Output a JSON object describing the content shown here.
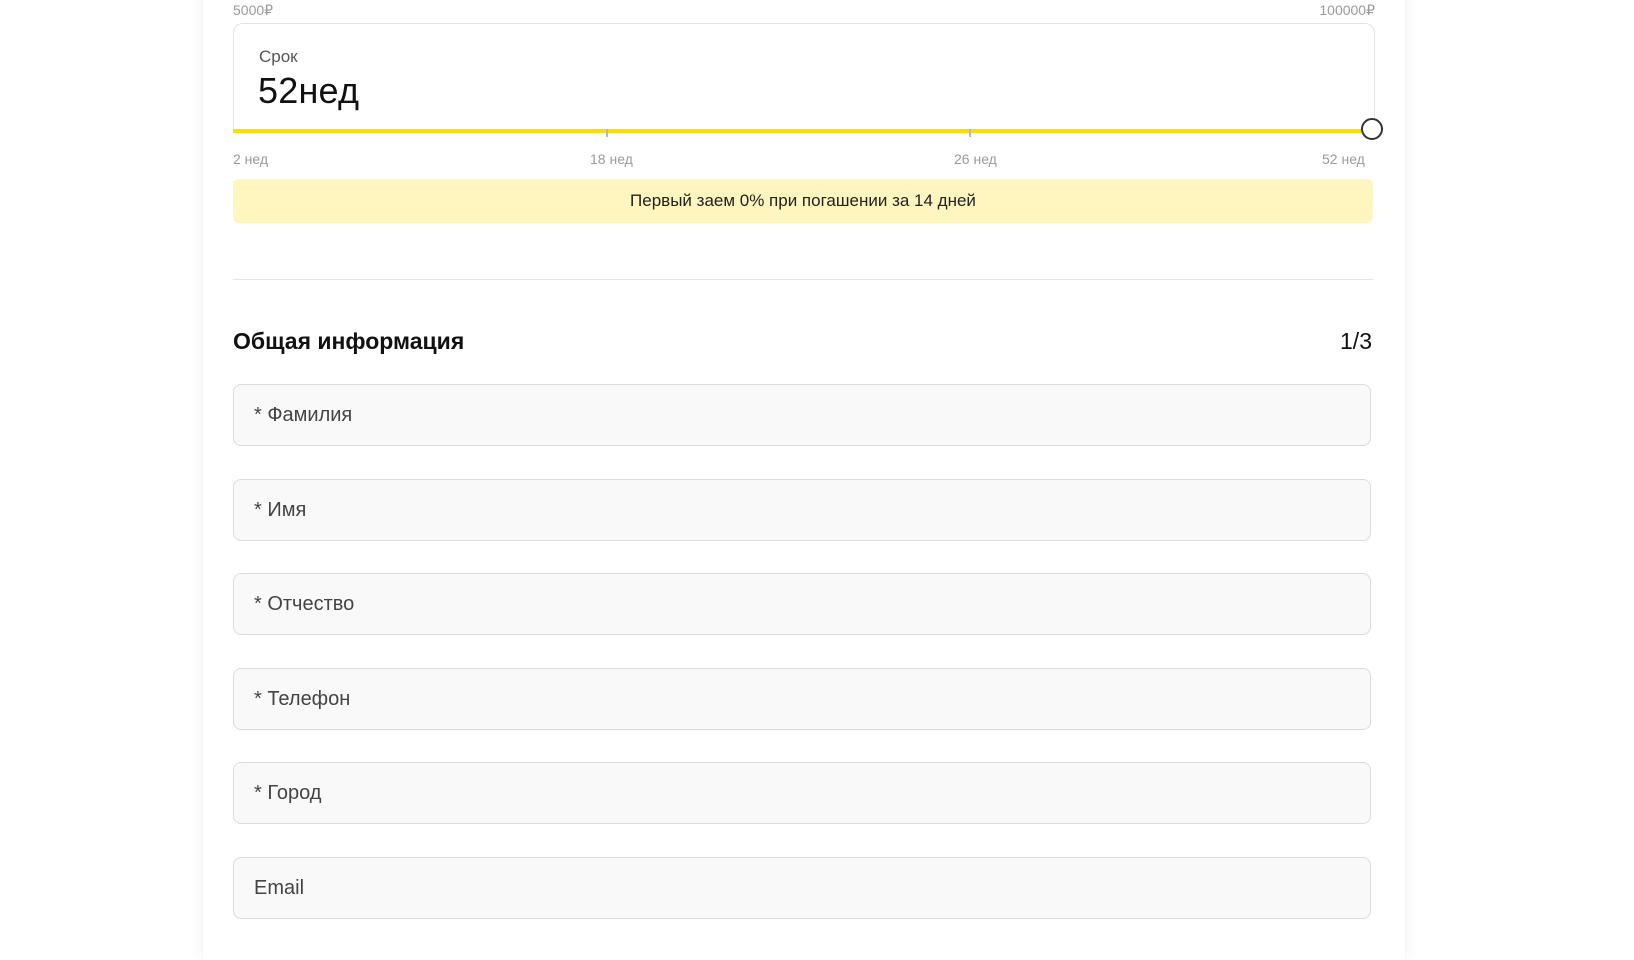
{
  "amount_range": {
    "min_label": "5000₽",
    "max_label": "100000₽"
  },
  "term": {
    "label": "Срок",
    "value": "52",
    "unit": "нед",
    "slider_fraction": 1.0,
    "tick_labels": [
      "2 нед",
      "18 нед",
      "26 нед",
      "52 нед"
    ]
  },
  "promo": {
    "text": "Первый заем 0% при погашении за 14 дней"
  },
  "section": {
    "title": "Общая информация",
    "step": "1/3"
  },
  "fields": [
    {
      "placeholder": "* Фамилия",
      "value": ""
    },
    {
      "placeholder": "* Имя",
      "value": ""
    },
    {
      "placeholder": "* Отчество",
      "value": ""
    },
    {
      "placeholder": "* Телефон",
      "value": ""
    },
    {
      "placeholder": "* Город",
      "value": ""
    },
    {
      "placeholder": "Email",
      "value": ""
    }
  ],
  "colors": {
    "slider_track": "#f7e000",
    "promo_background": "#fff5bf",
    "field_background": "#f9f9fa"
  }
}
